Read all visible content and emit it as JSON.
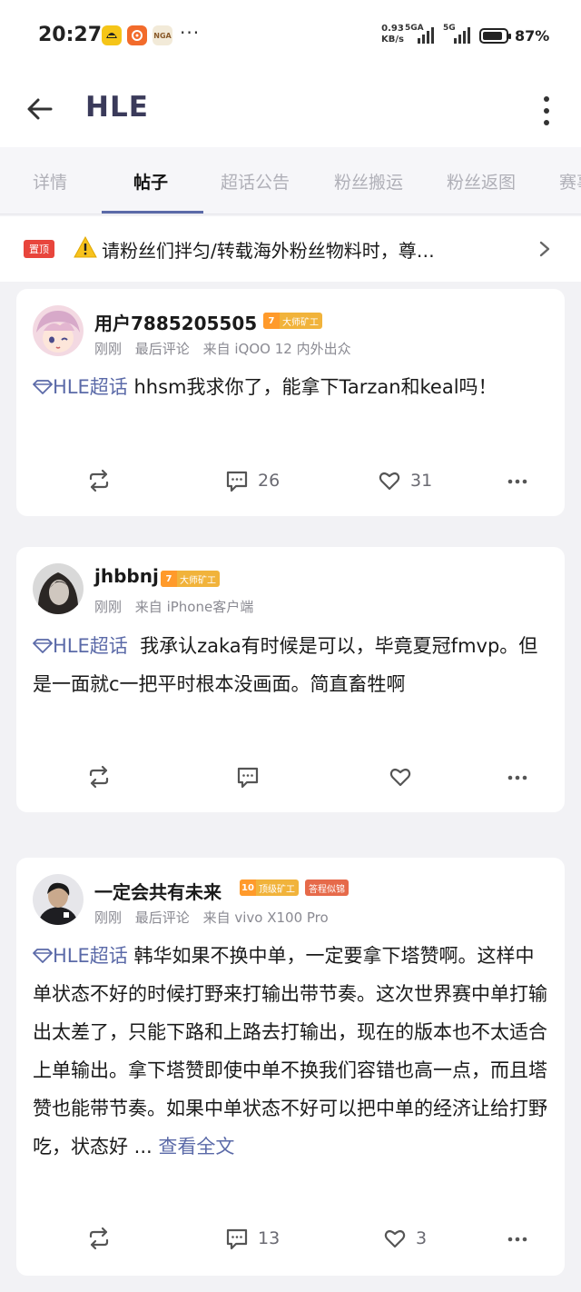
{
  "status_bar": {
    "time": "20:27",
    "app_icons": [
      "app-icon",
      "game-icon",
      "NGA"
    ],
    "more": "···",
    "net_speed_value": "0.93",
    "net_speed_unit": "KB/s",
    "network_1": "5GA",
    "network_2": "5G",
    "battery_level": 0.87,
    "battery_text": "87%"
  },
  "header": {
    "title": "HLE",
    "back_icon": "arrow-left-icon",
    "more_icon": "more-vertical-icon"
  },
  "tabs": [
    "详情",
    "帖子",
    "超话公告",
    "粉丝搬运",
    "粉丝返图",
    "赛事"
  ],
  "active_tab": "帖子",
  "pinned": {
    "badge": "置顶",
    "icon": "warning-icon",
    "text": "请粉丝们拌匀/转载海外粉丝物料时，尊…"
  },
  "colors": {
    "accent": "#5b6aa8",
    "pin_red": "#e8453c",
    "level_orange": "#f1b33b",
    "tag_red": "#e66a4a"
  },
  "posts": [
    {
      "username": "用户7885205505",
      "level": "7",
      "level_title": "大师矿工",
      "meta": [
        "刚刚",
        "最后评论",
        "来自 iQOO 12 内外出众"
      ],
      "topic": "HLE超话",
      "content": "hhsm我求你了，能拿下Tarzan和keal吗！",
      "comments": "26",
      "likes": "31"
    },
    {
      "username": "jhbbnj",
      "level": "7",
      "level_title": "大师矿工",
      "meta": [
        "刚刚",
        "来自 iPhone客户端"
      ],
      "topic": "HLE超话",
      "content": "我承认zaka有时候是可以，毕竟夏冠fmvp。但是一面就c一把平时根本没画面。简直畜牲啊",
      "comments": "",
      "likes": ""
    },
    {
      "username": "一定会共有未来",
      "level": "10",
      "level_title": "顶级矿工",
      "tag": "答程似锦",
      "meta": [
        "刚刚",
        "最后评论",
        "来自 vivo X100 Pro"
      ],
      "topic": "HLE超话",
      "content": "韩华如果不换中单，一定要拿下塔赞啊。这样中单状态不好的时候打野来打输出带节奏。这次世界赛中单打输出太差了，只能下路和上路去打输出，现在的版本也不太适合上单输出。拿下塔赞即使中单不换我们容错也高一点，而且塔赞也能带节奏。如果中单状态不好可以把中单的经济让给打野吃，状态好",
      "ellipsis": " ...",
      "read_more": "查看全文",
      "comments": "13",
      "likes": "3"
    }
  ]
}
